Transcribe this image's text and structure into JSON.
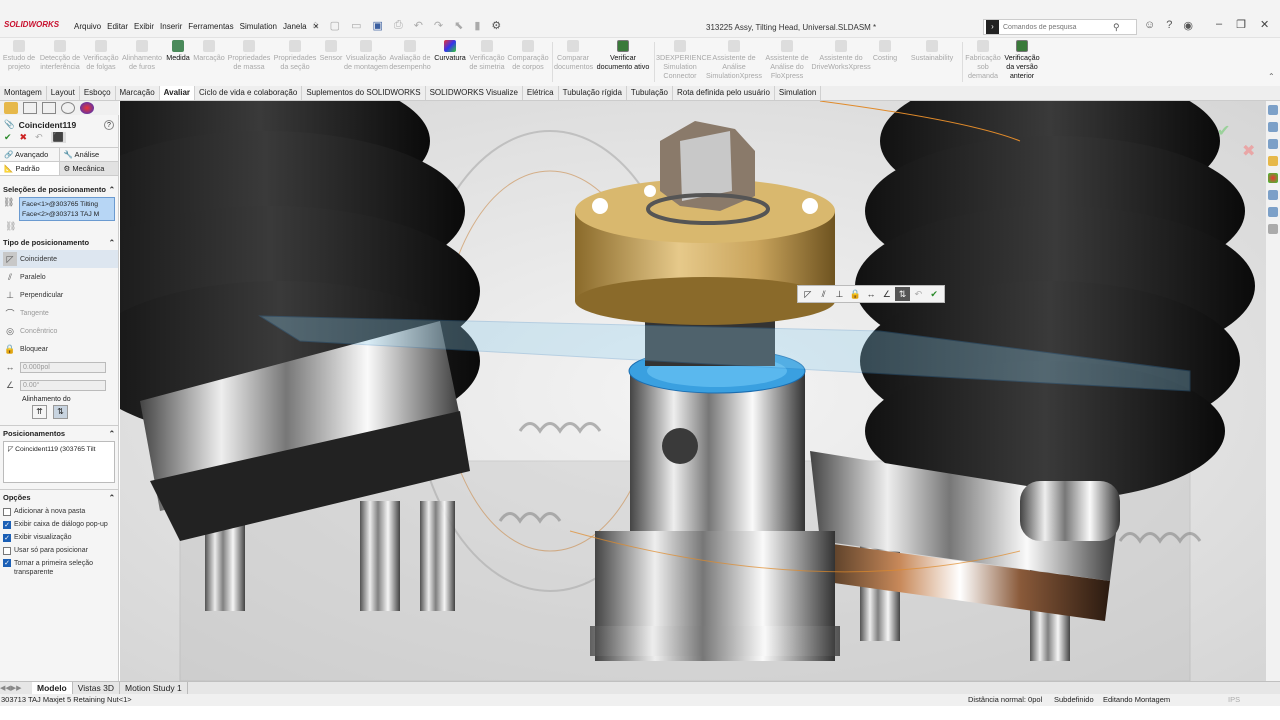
{
  "app": {
    "logo": "SOLIDWORKS",
    "document_title": "313225 Assy, Tilting Head, Universal.SLDASM *"
  },
  "menu": [
    "Arquivo",
    "Editar",
    "Exibir",
    "Inserir",
    "Ferramentas",
    "Simulation",
    "Janela"
  ],
  "search": {
    "placeholder": "Comandos de pesquisa"
  },
  "ribbon": [
    {
      "label": "Estudo de projeto"
    },
    {
      "label": "Detecção de interferência"
    },
    {
      "label": "Verificação de folgas"
    },
    {
      "label": "Alinhamento de furos"
    },
    {
      "label": "Medida"
    },
    {
      "label": "Marcação"
    },
    {
      "label": "Propriedades de massa"
    },
    {
      "label": "Propriedades da seção"
    },
    {
      "label": "Sensor"
    },
    {
      "label": "Visualização de montagem"
    },
    {
      "label": "Avaliação de desempenho"
    },
    {
      "label": "Curvatura"
    },
    {
      "label": "Verificação de simetria"
    },
    {
      "label": "Comparação de corpos"
    },
    {
      "label": "Comparar documentos"
    },
    {
      "label": "Verificar documento ativo"
    },
    {
      "label": "3DEXPERIENCE Simulation Connector"
    },
    {
      "label": "Assistente de Análise SimulationXpress"
    },
    {
      "label": "Assistente de Análise do FloXpress"
    },
    {
      "label": "Assistente do DriveWorksXpress"
    },
    {
      "label": "Costing"
    },
    {
      "label": "Sustainability"
    },
    {
      "label": "Fabricação sob demanda"
    },
    {
      "label": "Verificação da versão anterior"
    }
  ],
  "tabs": [
    "Montagem",
    "Layout",
    "Esboço",
    "Marcação",
    "Avaliar",
    "Ciclo de vida e colaboração",
    "Suplementos do SOLIDWORKS",
    "SOLIDWORKS Visualize",
    "Elétrica",
    "Tubulação rígida",
    "Tubulação",
    "Rota definida pelo usuário",
    "Simulation"
  ],
  "active_tab": "Avaliar",
  "property_manager": {
    "title": "Coincident119",
    "tab_advanced": "Avançado",
    "tab_analysis": "Análise",
    "tab_standard": "Padrão",
    "tab_mechanical": "Mecânica",
    "selections_header": "Seleções de posicionamento",
    "selections": [
      "Face<1>@303765 Tilting",
      "Face<2>@303713 TAJ M"
    ],
    "mate_type_header": "Tipo de posicionamento",
    "mate_types": [
      "Coincidente",
      "Paralelo",
      "Perpendicular",
      "Tangente",
      "Concêntrico",
      "Bloquear"
    ],
    "distance_value": "0.000pol",
    "angle_value": "0.00°",
    "alignment_label": "Alinhamento do",
    "mates_header": "Posicionamentos",
    "mates": [
      "Coincident119 (303765 Tilt"
    ],
    "options_header": "Opções",
    "options": [
      {
        "label": "Adicionar à nova pasta",
        "checked": false
      },
      {
        "label": "Exibir caixa de diálogo pop-up",
        "checked": true
      },
      {
        "label": "Exibir visualização",
        "checked": true
      },
      {
        "label": "Usar só para  posicionar",
        "checked": false
      },
      {
        "label": "Tornar a primeira seleção transparente",
        "checked": true
      }
    ]
  },
  "bottom_tabs": [
    "Modelo",
    "Vistas 3D",
    "Motion Study 1"
  ],
  "status": {
    "left": "303713 TAJ Maxjet 5 Retaining Nut<1>",
    "distance": "Distância normal: 0pol",
    "defined": "Subdefinido",
    "mode": "Editando Montagem",
    "units": "IPS"
  }
}
